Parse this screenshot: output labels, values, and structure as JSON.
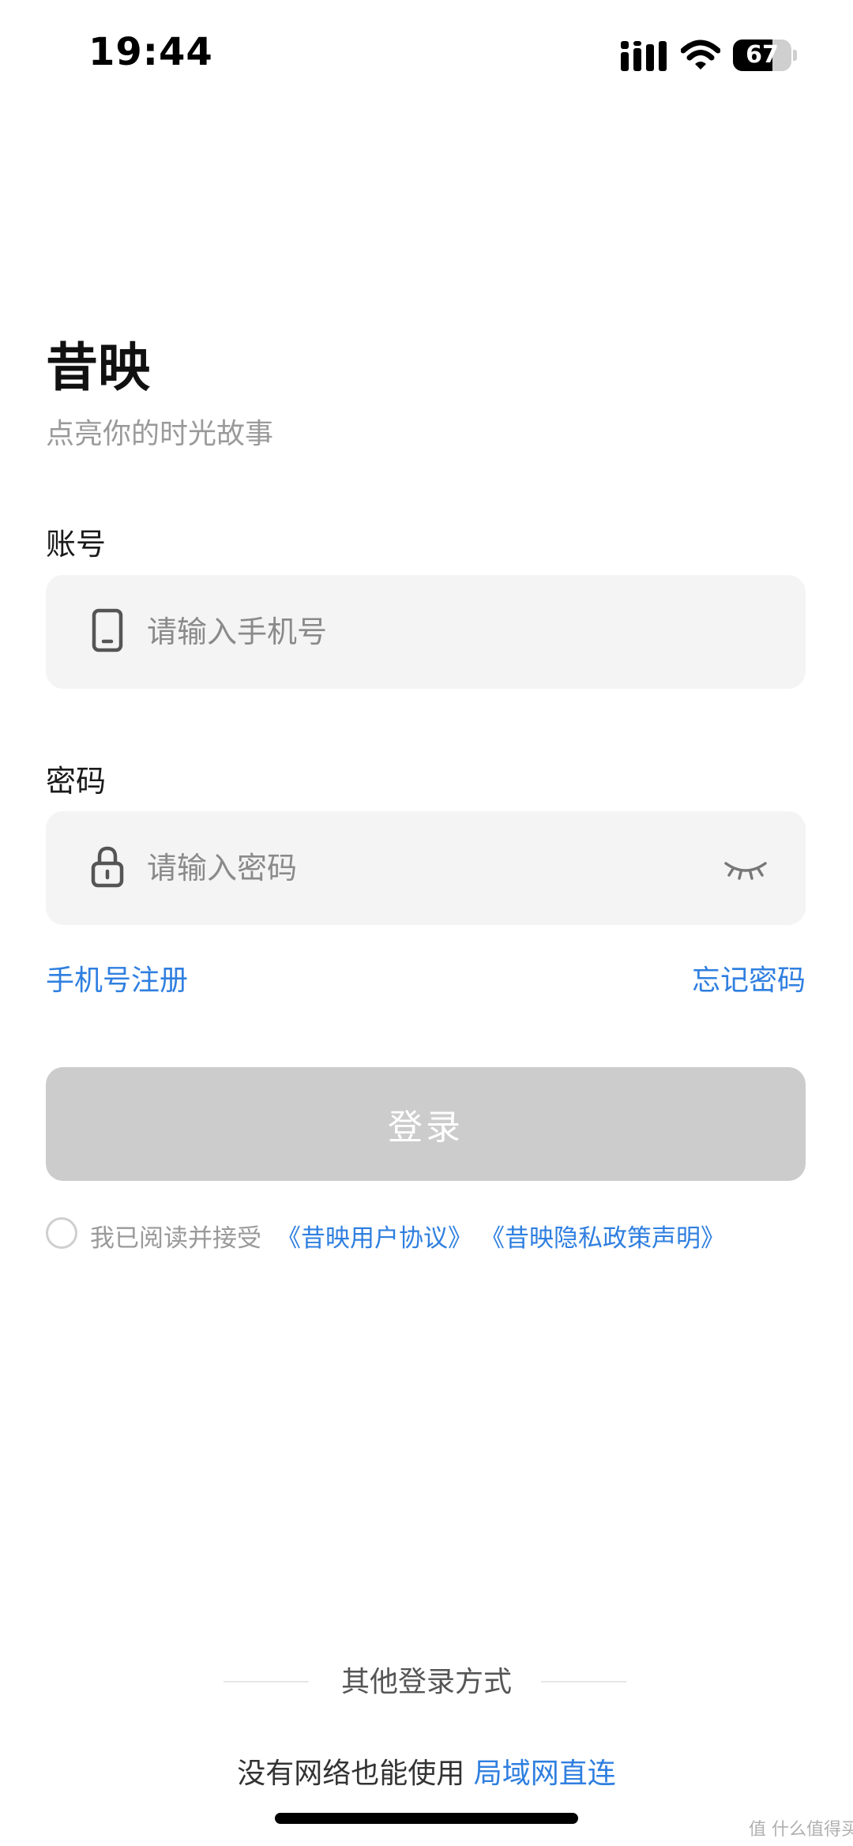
{
  "status_bar": {
    "time": "19:44",
    "battery_percent": "67",
    "battery_level": 0.67
  },
  "header": {
    "app_name": "昔映",
    "slogan": "点亮你的时光故事"
  },
  "account": {
    "label": "账号",
    "placeholder": "请输入手机号",
    "value": "",
    "icon": "phone-icon"
  },
  "password": {
    "label": "密码",
    "placeholder": "请输入密码",
    "value": "",
    "icon": "lock-icon",
    "toggle_icon": "eye-closed-icon"
  },
  "links": {
    "register": "手机号注册",
    "forgot": "忘记密码"
  },
  "login_button": {
    "label": "登录",
    "enabled": false
  },
  "agreement": {
    "checked": false,
    "text": "我已阅读并接受",
    "user_agreement": "《昔映用户协议》",
    "privacy_policy": "《昔映隐私政策声明》"
  },
  "other_login": {
    "label": "其他登录方式"
  },
  "offline": {
    "text": "没有网络也能使用",
    "link": "局域网直连"
  },
  "watermark": "值 什么值得买",
  "colors": {
    "link": "#2f7fe0",
    "input_bg": "#f4f4f4",
    "button_disabled": "#cccccc"
  }
}
